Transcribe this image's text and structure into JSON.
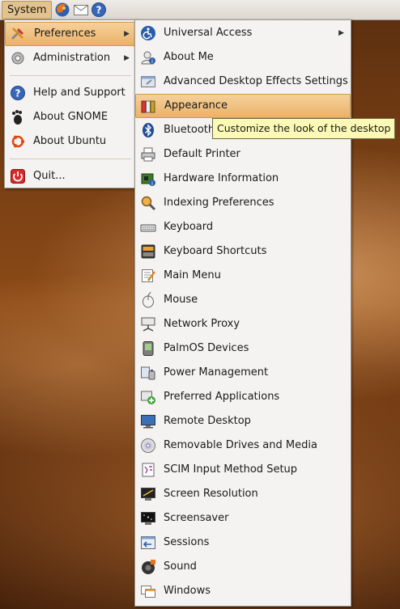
{
  "panel": {
    "system_label": "System",
    "launchers": [
      {
        "icon": "firefox-icon"
      },
      {
        "icon": "mail-icon"
      },
      {
        "icon": "help-icon"
      }
    ]
  },
  "system_menu": {
    "items": [
      {
        "label": "Preferences",
        "icon": "preferences-icon",
        "submenu": true,
        "highlighted": true
      },
      {
        "label": "Administration",
        "icon": "administration-icon",
        "submenu": true
      },
      {
        "label": "Help and Support",
        "icon": "help-icon"
      },
      {
        "label": "About GNOME",
        "icon": "gnome-icon"
      },
      {
        "label": "About Ubuntu",
        "icon": "ubuntu-icon"
      },
      {
        "label": "Quit...",
        "icon": "quit-icon"
      }
    ]
  },
  "preferences_menu": {
    "items": [
      {
        "label": "Universal Access",
        "icon": "accessibility-icon",
        "submenu": true
      },
      {
        "label": "About Me",
        "icon": "about-me-icon"
      },
      {
        "label": "Advanced Desktop Effects Settings",
        "icon": "desktop-effects-icon"
      },
      {
        "label": "Appearance",
        "icon": "appearance-icon",
        "highlighted": true
      },
      {
        "label": "Bluetooth",
        "icon": "bluetooth-icon"
      },
      {
        "label": "Default Printer",
        "icon": "printer-icon"
      },
      {
        "label": "Hardware Information",
        "icon": "hardware-icon"
      },
      {
        "label": "Indexing Preferences",
        "icon": "indexing-icon"
      },
      {
        "label": "Keyboard",
        "icon": "keyboard-icon"
      },
      {
        "label": "Keyboard Shortcuts",
        "icon": "keyboard-shortcuts-icon"
      },
      {
        "label": "Main Menu",
        "icon": "main-menu-icon"
      },
      {
        "label": "Mouse",
        "icon": "mouse-icon"
      },
      {
        "label": "Network Proxy",
        "icon": "network-proxy-icon"
      },
      {
        "label": "PalmOS Devices",
        "icon": "palm-icon"
      },
      {
        "label": "Power Management",
        "icon": "power-icon"
      },
      {
        "label": "Preferred Applications",
        "icon": "preferred-apps-icon"
      },
      {
        "label": "Remote Desktop",
        "icon": "remote-desktop-icon"
      },
      {
        "label": "Removable Drives and Media",
        "icon": "removable-media-icon"
      },
      {
        "label": "SCIM Input Method Setup",
        "icon": "scim-icon"
      },
      {
        "label": "Screen Resolution",
        "icon": "screen-resolution-icon"
      },
      {
        "label": "Screensaver",
        "icon": "screensaver-icon"
      },
      {
        "label": "Sessions",
        "icon": "sessions-icon"
      },
      {
        "label": "Sound",
        "icon": "sound-icon"
      },
      {
        "label": "Windows",
        "icon": "windows-icon"
      }
    ]
  },
  "tooltip": "Customize the look of the desktop",
  "colors": {
    "highlight": "#eab269",
    "menu_bg": "#f5f3f1",
    "tooltip_bg": "#fbf9b5"
  }
}
